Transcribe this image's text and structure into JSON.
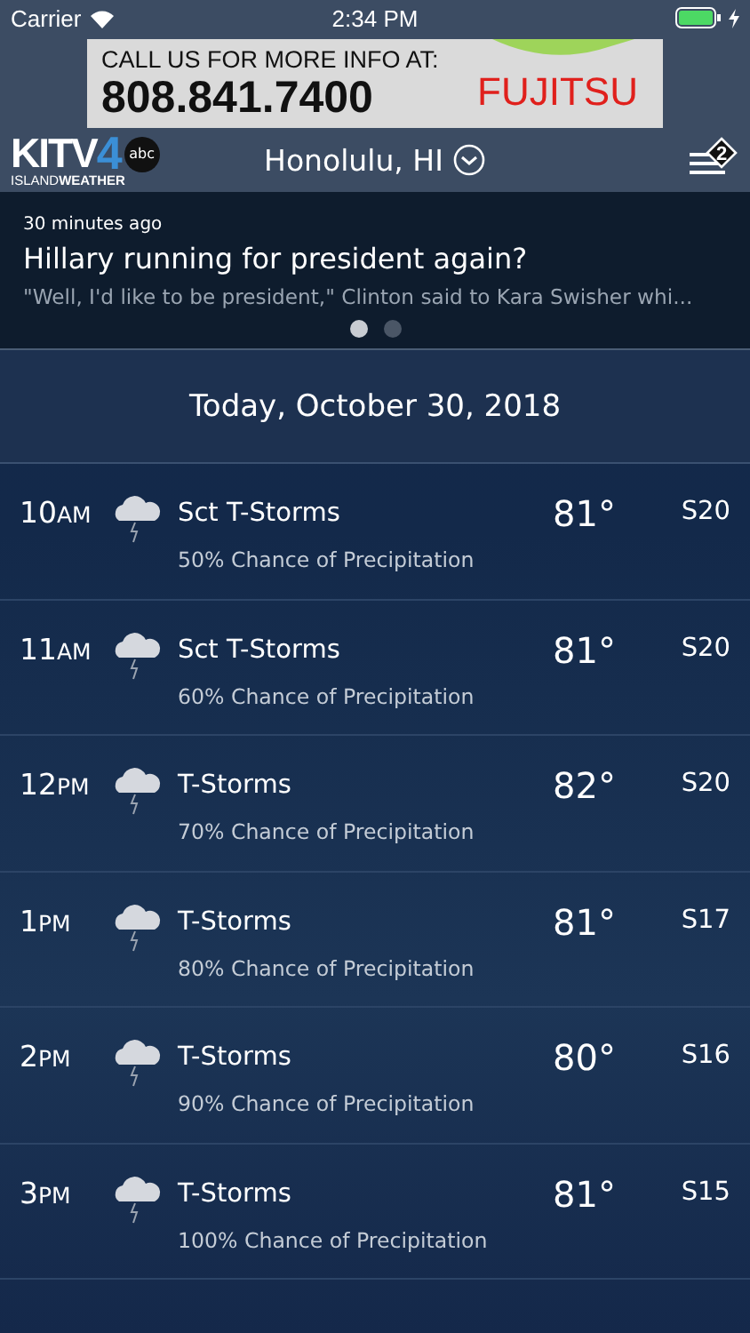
{
  "status_bar": {
    "carrier": "Carrier",
    "time": "2:34 PM",
    "charging": true
  },
  "ad": {
    "line_1": "CALL US FOR MORE INFO AT:",
    "line_2": "808.841.7400",
    "brand": "FUJITSU"
  },
  "nav": {
    "logo": {
      "main": "KITV",
      "number": "4",
      "network": "abc",
      "sub_1": "ISLAND",
      "sub_2": "WEATHER"
    },
    "location": "Honolulu, HI",
    "alert_count": "2"
  },
  "news": {
    "time": "30 minutes ago",
    "headline": "Hillary running for president again?",
    "summary": "\"Well, I'd like to be president,\" Clinton said to Kara Swisher whi...",
    "pages": [
      {
        "selected": true
      },
      {
        "selected": false
      }
    ]
  },
  "date_header": "Today, October 30, 2018",
  "hours": [
    {
      "hour": "10",
      "period": "AM",
      "condition": "Sct T-Storms",
      "precip": "50% Chance of Precipitation",
      "temp": "81°",
      "wind": "S20"
    },
    {
      "hour": "11",
      "period": "AM",
      "condition": "Sct T-Storms",
      "precip": "60% Chance of Precipitation",
      "temp": "81°",
      "wind": "S20"
    },
    {
      "hour": "12",
      "period": "PM",
      "condition": "T-Storms",
      "precip": "70% Chance of Precipitation",
      "temp": "82°",
      "wind": "S20"
    },
    {
      "hour": "1",
      "period": "PM",
      "condition": "T-Storms",
      "precip": "80% Chance of Precipitation",
      "temp": "81°",
      "wind": "S17"
    },
    {
      "hour": "2",
      "period": "PM",
      "condition": "T-Storms",
      "precip": "90% Chance of Precipitation",
      "temp": "80°",
      "wind": "S16"
    },
    {
      "hour": "3",
      "period": "PM",
      "condition": "T-Storms",
      "precip": "100% Chance of Precipitation",
      "temp": "81°",
      "wind": "S15"
    }
  ]
}
